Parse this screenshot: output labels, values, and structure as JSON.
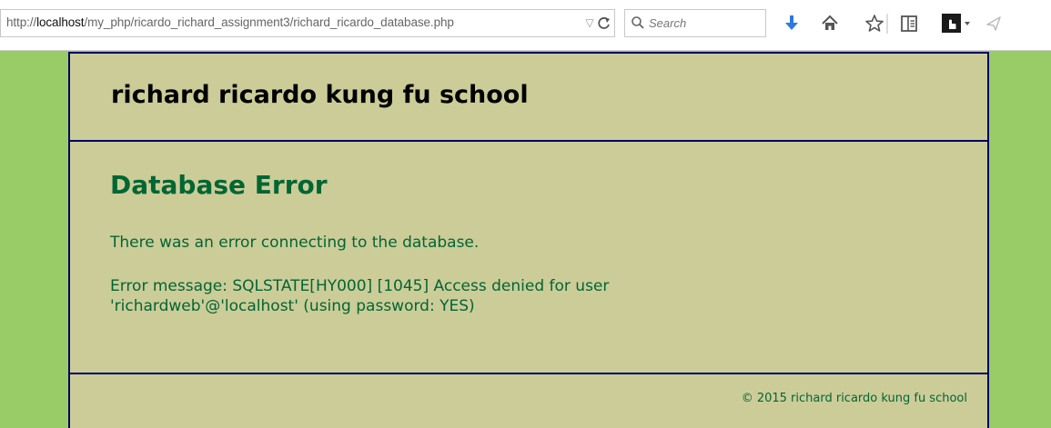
{
  "browser": {
    "url_prefix": "http://",
    "url_host": "localhost",
    "url_path": "/my_php/ricardo_richard_assignment3/richard_ricardo_database.php",
    "search_placeholder": "Search"
  },
  "page": {
    "site_title": "richard ricardo kung fu school",
    "error_heading": "Database Error",
    "error_intro": "There was an error connecting to the database.",
    "error_message": "Error message: SQLSTATE[HY000] [1045] Access denied for user 'richardweb'@'localhost' (using password: YES)",
    "footer_text": "© 2015 richard ricardo kung fu school"
  },
  "colors": {
    "page_background": "#99cc66",
    "content_background": "#cccc99",
    "border": "#000066",
    "error_text": "#006633",
    "download_icon": "#2a7ae2"
  },
  "icons": [
    "search-icon",
    "reload-icon",
    "dropdown-arrow-icon",
    "download-icon",
    "home-icon",
    "star-icon",
    "reading-list-icon",
    "extension-icon",
    "share-icon"
  ]
}
